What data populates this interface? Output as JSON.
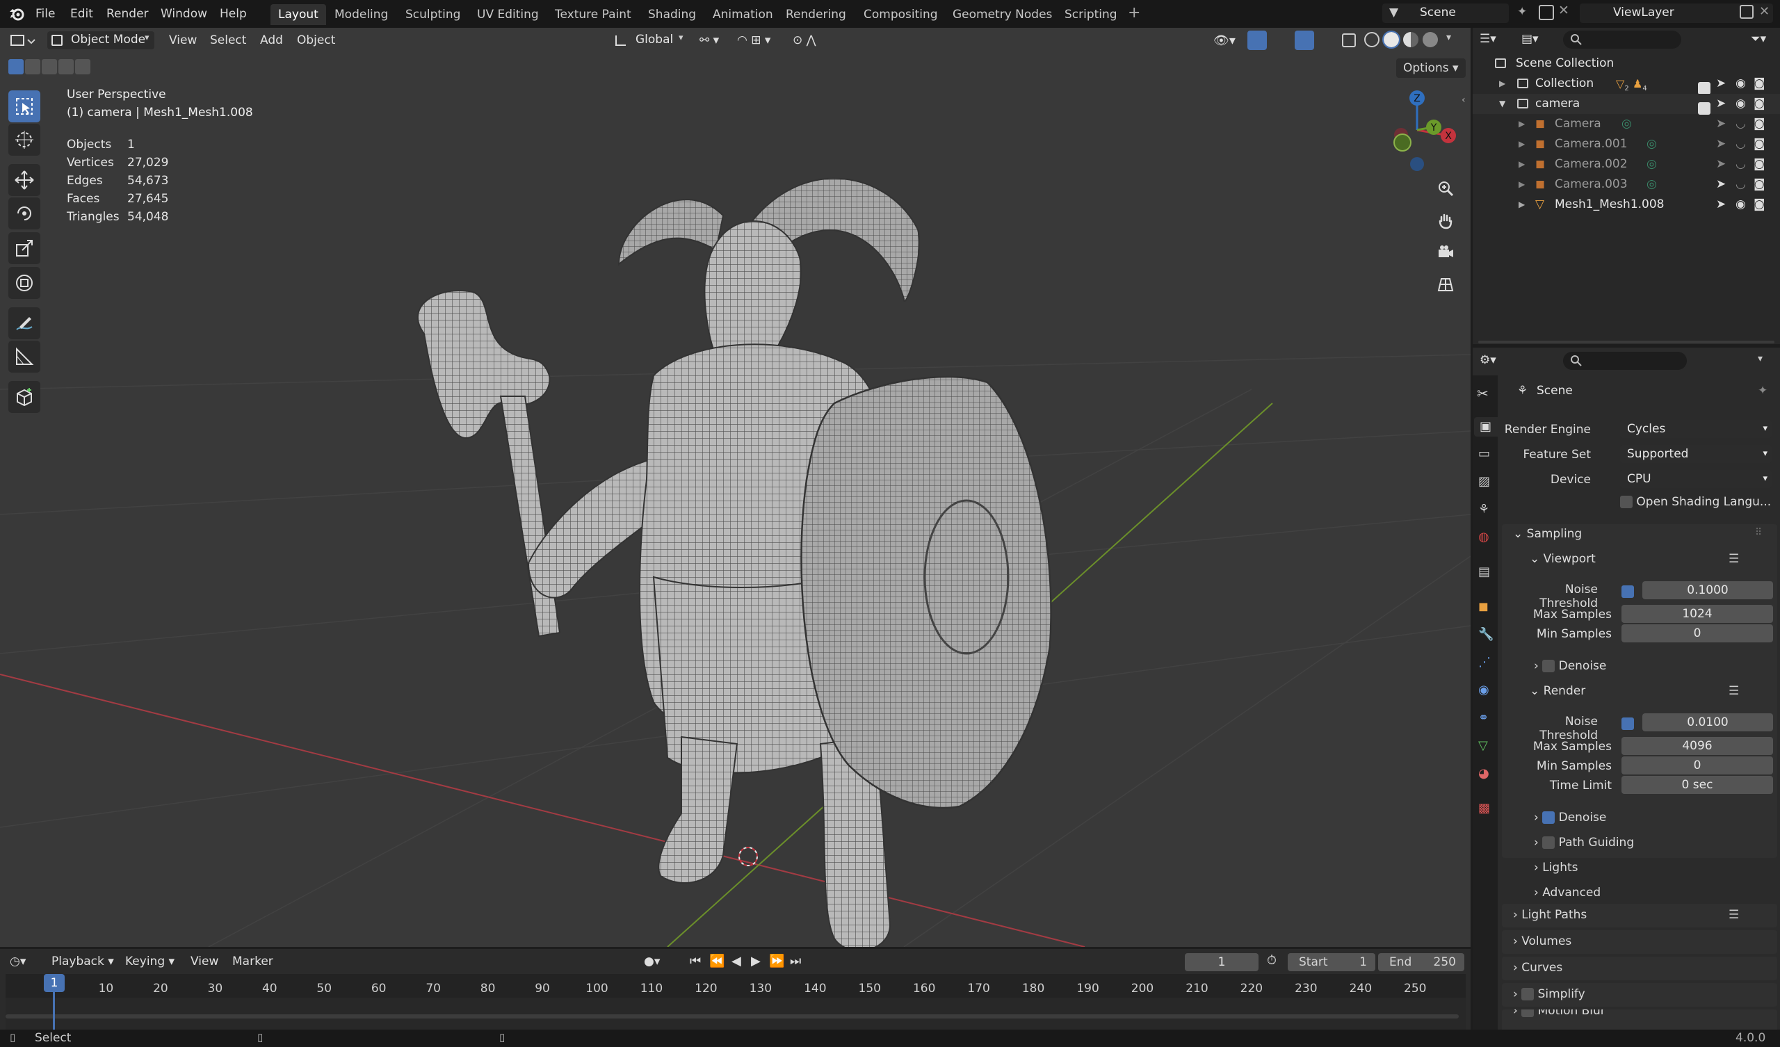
{
  "menu": {
    "file": "File",
    "edit": "Edit",
    "render": "Render",
    "window": "Window",
    "help": "Help"
  },
  "workspaces": [
    "Layout",
    "Modeling",
    "Sculpting",
    "UV Editing",
    "Texture Paint",
    "Shading",
    "Animation",
    "Rendering",
    "Compositing",
    "Geometry Nodes",
    "Scripting"
  ],
  "topright": {
    "scene": "Scene",
    "viewlayer": "ViewLayer"
  },
  "viewport": {
    "mode": "Object Mode",
    "view": "View",
    "select": "Select",
    "add": "Add",
    "object": "Object",
    "orientation": "Global",
    "options": "Options",
    "info_title": "User Perspective",
    "info_sub": "(1) camera | Mesh1_Mesh1.008",
    "stats": [
      {
        "label": "Objects",
        "value": "1"
      },
      {
        "label": "Vertices",
        "value": "27,029"
      },
      {
        "label": "Edges",
        "value": "54,673"
      },
      {
        "label": "Faces",
        "value": "27,645"
      },
      {
        "label": "Triangles",
        "value": "54,048"
      }
    ],
    "gizmo": {
      "z": "Z",
      "y": "Y",
      "x": "X"
    }
  },
  "outliner": {
    "root": "Scene Collection",
    "collection": "Collection",
    "collection_badges": [
      "2",
      "4"
    ],
    "camera": "camera",
    "items": [
      "Camera",
      "Camera.001",
      "Camera.002",
      "Camera.003",
      "Mesh1_Mesh1.008"
    ]
  },
  "properties": {
    "context": "Scene",
    "render_engine_label": "Render Engine",
    "render_engine": "Cycles",
    "feature_set_label": "Feature Set",
    "feature_set": "Supported",
    "device_label": "Device",
    "device": "CPU",
    "osl": "Open Shading Langu...",
    "sampling": "Sampling",
    "viewport": "Viewport",
    "noise_threshold_label": "Noise Threshold",
    "vp_noise": "0.1000",
    "max_samples_label": "Max Samples",
    "vp_max": "1024",
    "min_samples_label": "Min Samples",
    "vp_min": "0",
    "denoise": "Denoise",
    "render": "Render",
    "r_noise": "0.0100",
    "r_max": "4096",
    "r_min": "0",
    "time_limit_label": "Time Limit",
    "time_limit": "0 sec",
    "path_guiding": "Path Guiding",
    "lights": "Lights",
    "advanced": "Advanced",
    "light_paths": "Light Paths",
    "volumes": "Volumes",
    "curves": "Curves",
    "simplify": "Simplify",
    "motion_blur": "Motion Blur"
  },
  "timeline": {
    "playback": "Playback",
    "keying": "Keying",
    "view": "View",
    "marker": "Marker",
    "current": "1",
    "start_label": "Start",
    "start": "1",
    "end_label": "End",
    "end": "250",
    "frames": [
      "10",
      "20",
      "30",
      "40",
      "50",
      "60",
      "70",
      "80",
      "90",
      "100",
      "110",
      "120",
      "130",
      "140",
      "150",
      "160",
      "170",
      "180",
      "190",
      "200",
      "210",
      "220",
      "230",
      "240",
      "250"
    ],
    "playhead": "1"
  },
  "status": {
    "select": "Select",
    "version": "4.0.0"
  }
}
